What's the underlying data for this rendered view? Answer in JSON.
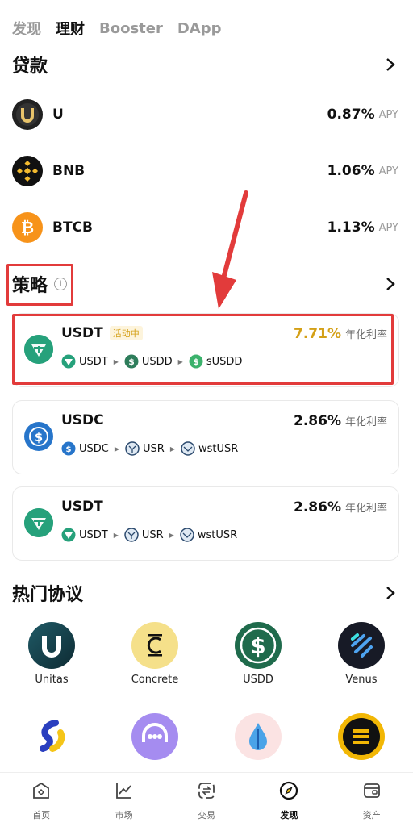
{
  "topnav": {
    "tabs": [
      {
        "label": "发现"
      },
      {
        "label": "理财"
      },
      {
        "label": "Booster"
      },
      {
        "label": "DApp"
      }
    ],
    "active": 1
  },
  "loans": {
    "title": "贷款",
    "items": [
      {
        "name": "U",
        "rate": "0.87%",
        "unit": "APY"
      },
      {
        "name": "BNB",
        "rate": "1.06%",
        "unit": "APY"
      },
      {
        "name": "BTCB",
        "rate": "1.13%",
        "unit": "APY"
      }
    ]
  },
  "strategy": {
    "title": "策略",
    "info_glyph": "i",
    "cards": [
      {
        "title": "USDT",
        "badge": "活动中",
        "rate": "7.71%",
        "rate_label": "年化利率",
        "rate_color": "#d4a017",
        "path": [
          "USDT",
          "USDD",
          "sUSDD"
        ]
      },
      {
        "title": "USDC",
        "rate": "2.86%",
        "rate_label": "年化利率",
        "path": [
          "USDC",
          "USR",
          "wstUSR"
        ]
      },
      {
        "title": "USDT",
        "rate": "2.86%",
        "rate_label": "年化利率",
        "path": [
          "USDT",
          "USR",
          "wstUSR"
        ]
      }
    ]
  },
  "protocols": {
    "title": "热门协议",
    "row1": [
      {
        "name": "Unitas"
      },
      {
        "name": "Concrete"
      },
      {
        "name": "USDD"
      },
      {
        "name": "Venus"
      }
    ]
  },
  "bottom_nav": {
    "items": [
      {
        "label": "首页"
      },
      {
        "label": "市场"
      },
      {
        "label": "交易"
      },
      {
        "label": "发现"
      },
      {
        "label": "资产"
      }
    ],
    "active": 3
  },
  "colors": {
    "highlight": "#e23b3b",
    "tether": "#26a17b",
    "usdc": "#2775ca",
    "usdd": "#2e7d5b"
  }
}
